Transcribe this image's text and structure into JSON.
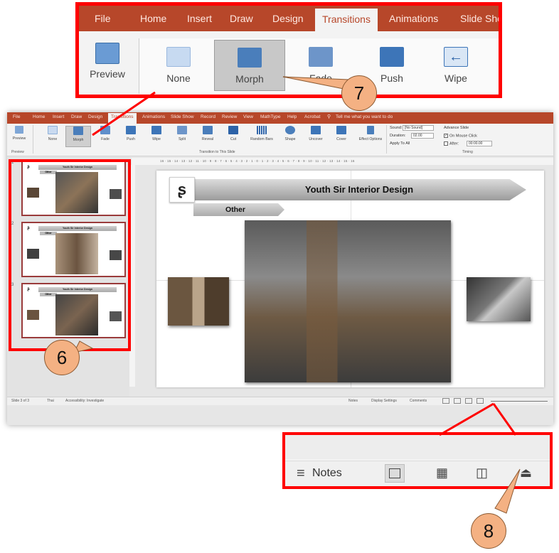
{
  "colors": {
    "accent": "#b7472a",
    "highlight_red": "#ff0000",
    "callout_fill": "#f4b183"
  },
  "main_window": {
    "tabs": [
      "File",
      "Home",
      "Insert",
      "Draw",
      "Design",
      "Transitions",
      "Animations",
      "Slide Show",
      "Record",
      "Review",
      "View",
      "MathType",
      "Help",
      "Acrobat"
    ],
    "tell_me": "Tell me what you want to do",
    "preview_label": "Preview",
    "preview_group": "Preview",
    "transitions": [
      "None",
      "Morph",
      "Fade",
      "Push",
      "Wipe",
      "Split",
      "Reveal",
      "Cut",
      "Random Bars",
      "Shape",
      "Uncover",
      "Cover"
    ],
    "selected_transition": "Morph",
    "effect_options": "Effect Options",
    "transition_group": "Transition to This Slide",
    "timing": {
      "sound_label": "Sound:",
      "sound_value": "[No Sound]",
      "duration_label": "Duration:",
      "duration_value": "02.00",
      "apply_all": "Apply To All",
      "advance_slide": "Advance Slide",
      "on_mouse_click": "On Mouse Click",
      "after_label": "After:",
      "after_value": "00:00.00",
      "group_label": "Timing"
    },
    "ruler_text": "16 · 15 · 14 · 13 · 12 · 11 · 10 · 9 · 8 · 7 · 6 · 5 · 4 · 3 · 2 · 1 · 0 · 1 · 2 · 3 · 4 · 5 · 6 · 7 · 8 · 9 · 10 · 11 · 12 · 13 · 14 · 15 · 16",
    "thumbnails": [
      {
        "num": "1",
        "title": "Youth Sir Interior Design",
        "other": "Other"
      },
      {
        "num": "2",
        "title": "Youth Sir Interior Design",
        "other": "Other"
      },
      {
        "num": "3",
        "title": "Youth Sir Interior Design",
        "other": "Other"
      }
    ],
    "slide": {
      "title": "Youth Sir Interior Design",
      "subtitle": "Other",
      "logo_glyph": "ʂ"
    },
    "status": {
      "slide_count": "Slide 3 of 3",
      "language": "Thai",
      "accessibility": "Accessibility: Investigate",
      "notes": "Notes",
      "display_settings": "Display Settings",
      "comments": "Comments"
    }
  },
  "zoom_top": {
    "tabs": [
      "File",
      "Home",
      "Insert",
      "Draw",
      "Design",
      "Transitions",
      "Animations",
      "Slide Sho"
    ],
    "active_tab": "Transitions",
    "preview_label": "Preview",
    "buttons": [
      "None",
      "Morph",
      "Fade",
      "Push",
      "Wipe"
    ],
    "selected": "Morph"
  },
  "zoom_bottom": {
    "notes_label": "Notes"
  },
  "callouts": [
    "7",
    "6",
    "8"
  ]
}
